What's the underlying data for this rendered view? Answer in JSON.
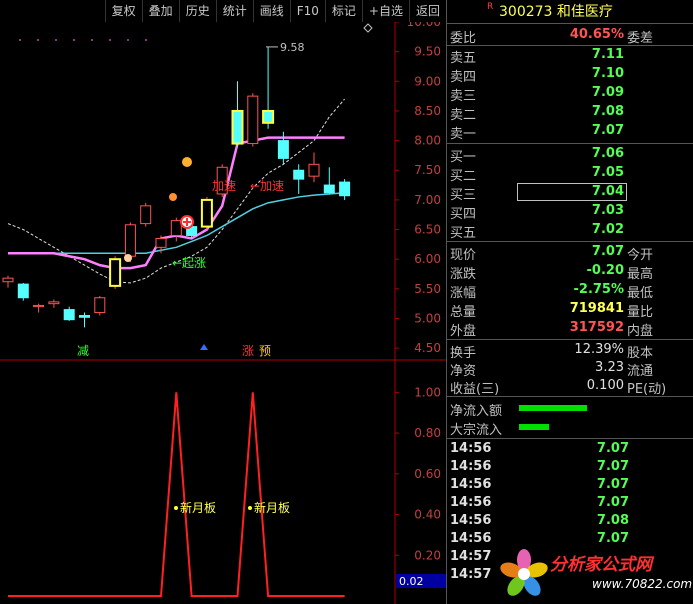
{
  "toolbar": {
    "buttons": [
      "复权",
      "叠加",
      "历史",
      "统计",
      "画线",
      "F10",
      "标记",
      "+自选",
      "返回"
    ]
  },
  "stock": {
    "badge": "R",
    "code": "300273",
    "name": "和佳医疗"
  },
  "quote": {
    "weibi_label": "委比",
    "weibi_value": "40.65%",
    "weicha_label": "委差",
    "asks": [
      {
        "label": "卖五",
        "price": "7.11"
      },
      {
        "label": "卖四",
        "price": "7.10"
      },
      {
        "label": "卖三",
        "price": "7.09"
      },
      {
        "label": "卖二",
        "price": "7.08"
      },
      {
        "label": "卖一",
        "price": "7.07"
      }
    ],
    "bids": [
      {
        "label": "买一",
        "price": "7.06"
      },
      {
        "label": "买二",
        "price": "7.05"
      },
      {
        "label": "买三",
        "price": "7.04"
      },
      {
        "label": "买四",
        "price": "7.03"
      },
      {
        "label": "买五",
        "price": "7.02"
      }
    ],
    "stats": [
      {
        "label": "现价",
        "value": "7.07",
        "label2": "今开",
        "color": "green"
      },
      {
        "label": "涨跌",
        "value": "-0.20",
        "label2": "最高",
        "color": "green"
      },
      {
        "label": "涨幅",
        "value": "-2.75%",
        "label2": "最低",
        "color": "green"
      },
      {
        "label": "总量",
        "value": "719841",
        "label2": "量比",
        "color": "yellow"
      },
      {
        "label": "外盘",
        "value": "317592",
        "label2": "内盘",
        "color": "red"
      }
    ],
    "finance": [
      {
        "label": "换手",
        "value": "12.39%",
        "label2": "股本"
      },
      {
        "label": "净资",
        "value": "3.23",
        "label2": "流通"
      },
      {
        "label": "收益(三)",
        "value": "0.100",
        "label2": "PE(动)"
      }
    ],
    "flows": [
      {
        "label": "净流入额"
      },
      {
        "label": "大宗流入"
      }
    ],
    "trades": [
      {
        "time": "14:56",
        "price": "7.07"
      },
      {
        "time": "14:56",
        "price": "7.07"
      },
      {
        "time": "14:56",
        "price": "7.07"
      },
      {
        "time": "14:56",
        "price": "7.07"
      },
      {
        "time": "14:56",
        "price": "7.08"
      },
      {
        "time": "14:56",
        "price": "7.07"
      },
      {
        "time": "14:57",
        "price": ""
      },
      {
        "time": "14:57",
        "price": ""
      }
    ]
  },
  "chart_data": [
    {
      "type": "candlestick",
      "title": "",
      "ylim": [
        4.3,
        10.0
      ],
      "yticks": [
        "10.00",
        "9.50",
        "9.00",
        "8.50",
        "8.00",
        "7.50",
        "7.00",
        "6.50",
        "6.00",
        "5.50",
        "5.00",
        "4.50"
      ],
      "high_marker": "9.58",
      "candles": [
        {
          "o": 5.62,
          "h": 5.72,
          "l": 5.52,
          "c": 5.68
        },
        {
          "o": 5.58,
          "h": 5.6,
          "l": 5.3,
          "c": 5.35
        },
        {
          "o": 5.2,
          "h": 5.25,
          "l": 5.1,
          "c": 5.22
        },
        {
          "o": 5.25,
          "h": 5.32,
          "l": 5.18,
          "c": 5.28
        },
        {
          "o": 5.15,
          "h": 5.2,
          "l": 4.96,
          "c": 4.98
        },
        {
          "o": 5.05,
          "h": 5.1,
          "l": 4.85,
          "c": 5.02
        },
        {
          "o": 5.1,
          "h": 5.38,
          "l": 5.05,
          "c": 5.35
        },
        {
          "o": 5.55,
          "h": 6.05,
          "l": 5.5,
          "c": 6.0
        },
        {
          "o": 6.05,
          "h": 6.62,
          "l": 5.95,
          "c": 6.58
        },
        {
          "o": 6.6,
          "h": 6.95,
          "l": 6.55,
          "c": 6.9
        },
        {
          "o": 6.2,
          "h": 6.4,
          "l": 6.1,
          "c": 6.35
        },
        {
          "o": 6.4,
          "h": 6.7,
          "l": 6.3,
          "c": 6.65
        },
        {
          "o": 6.55,
          "h": 6.6,
          "l": 6.35,
          "c": 6.4
        },
        {
          "o": 6.55,
          "h": 7.05,
          "l": 6.5,
          "c": 7.0
        },
        {
          "o": 7.1,
          "h": 7.6,
          "l": 7.05,
          "c": 7.55
        },
        {
          "o": 8.5,
          "h": 9.0,
          "l": 7.9,
          "c": 7.95
        },
        {
          "o": 7.95,
          "h": 8.8,
          "l": 7.9,
          "c": 8.75
        },
        {
          "o": 8.5,
          "h": 9.58,
          "l": 8.2,
          "c": 8.3
        },
        {
          "o": 8.0,
          "h": 8.15,
          "l": 7.6,
          "c": 7.7
        },
        {
          "o": 7.5,
          "h": 7.6,
          "l": 7.1,
          "c": 7.35
        },
        {
          "o": 7.4,
          "h": 7.8,
          "l": 7.3,
          "c": 7.6
        },
        {
          "o": 7.25,
          "h": 7.55,
          "l": 7.1,
          "c": 7.12
        },
        {
          "o": 7.3,
          "h": 7.35,
          "l": 7.0,
          "c": 7.07
        }
      ],
      "annotations": [
        "加速",
        "←加速",
        "←起涨",
        "减",
        "涨",
        "预"
      ]
    },
    {
      "type": "line",
      "title": "",
      "ylim": [
        0,
        1.1
      ],
      "yticks": [
        "1.00",
        "0.80",
        "0.60",
        "0.40",
        "0.20"
      ],
      "current_value": "0.02",
      "series": [
        {
          "values": [
            0,
            0,
            0,
            0,
            0,
            0,
            0,
            0,
            0,
            0,
            0,
            1,
            0,
            0,
            0,
            0,
            1,
            0,
            0,
            0,
            0,
            0,
            0
          ]
        }
      ],
      "annotations": [
        "新月板",
        "新月板"
      ]
    }
  ]
}
